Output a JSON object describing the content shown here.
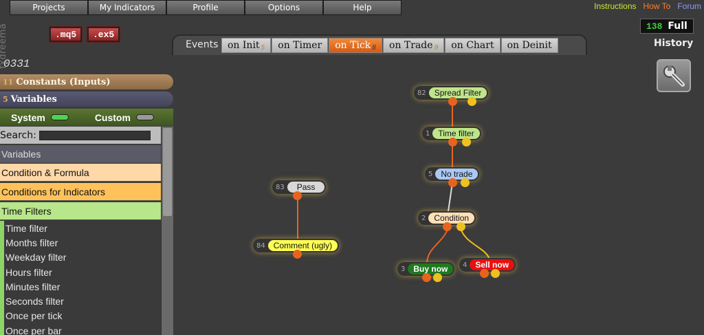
{
  "menu": [
    "Projects",
    "My Indicators",
    "Profile",
    "Options",
    "Help"
  ],
  "links": {
    "instructions": "Instructions",
    "howto": "How To",
    "forum": "Forum"
  },
  "brand": "fxdreema",
  "buttons": {
    "mq5": ".mq5",
    "ex5": ".ex5"
  },
  "counter": {
    "value": "138",
    "label": "Full"
  },
  "history": "History",
  "events_label": "Events",
  "tabs": [
    {
      "label": "on Init",
      "count": "5"
    },
    {
      "label": "on Timer",
      "count": ""
    },
    {
      "label": "on Tick",
      "count": "8"
    },
    {
      "label": "on Trade",
      "count": "9"
    },
    {
      "label": "on Chart",
      "count": ""
    },
    {
      "label": "on Deinit",
      "count": ""
    }
  ],
  "project_name": "0331",
  "constants": {
    "count": "11",
    "label": "Constants (Inputs)"
  },
  "variables": {
    "count": "5",
    "label": "Variables"
  },
  "system_label": "System",
  "custom_label": "Custom",
  "search_label": "Search:",
  "categories": [
    "Variables",
    "Condition & Formula",
    "Conditions for Indicators",
    "Time Filters"
  ],
  "time_filter_items": [
    "Time filter",
    "Months filter",
    "Weekday filter",
    "Hours filter",
    "Minutes filter",
    "Seconds filter",
    "Once per tick",
    "Once per bar"
  ],
  "nodes": [
    {
      "id": "82",
      "label": "Spread Filter"
    },
    {
      "id": "1",
      "label": "Time filter"
    },
    {
      "id": "5",
      "label": "No trade"
    },
    {
      "id": "2",
      "label": "Condition"
    },
    {
      "id": "3",
      "label": "Buy now"
    },
    {
      "id": "4",
      "label": "Sell now"
    },
    {
      "id": "83",
      "label": "Pass"
    },
    {
      "id": "84",
      "label": "Comment (ugly)"
    }
  ],
  "colors": {
    "accent": "#e8641e",
    "green_link": "#c8e830",
    "howto": "#ff7f27",
    "forum": "#8a9cff"
  }
}
